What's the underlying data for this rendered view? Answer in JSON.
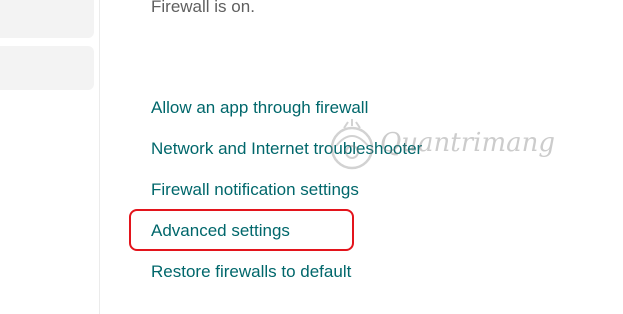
{
  "status": {
    "firewall_status": "Firewall is on."
  },
  "links": [
    {
      "label": "Allow an app through firewall"
    },
    {
      "label": "Network and Internet troubleshooter"
    },
    {
      "label": "Firewall notification settings"
    },
    {
      "label": "Advanced settings"
    },
    {
      "label": "Restore firewalls to default"
    }
  ],
  "annotation": {
    "highlight_color": "#e3141c",
    "highlighted_link": "Advanced settings"
  },
  "watermark": {
    "text": "Quantrimang"
  },
  "colors": {
    "link": "#00676b",
    "status_text": "#5f5f5f",
    "sidebar_item_bg": "#f3f3f3"
  }
}
